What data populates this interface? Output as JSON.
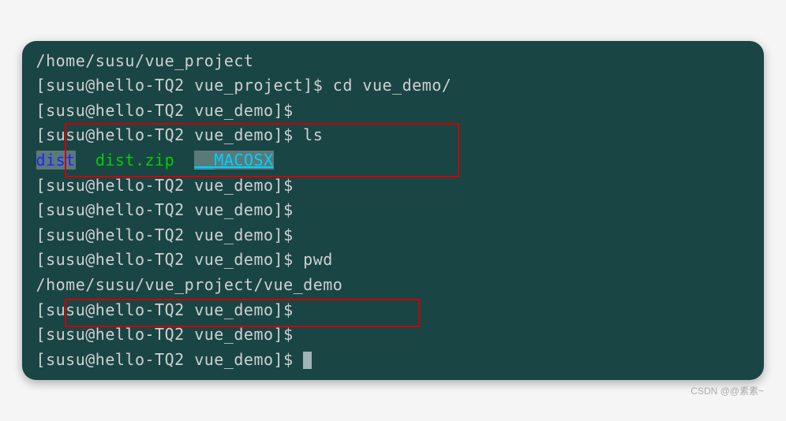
{
  "lines": {
    "pwd_output1": "/home/susu/vue_project",
    "prompt1": "[susu@hello-TQ2 vue_project]$ ",
    "cmd_cd": "cd vue_demo/",
    "prompt_demo": "[susu@hello-TQ2 vue_demo]$ ",
    "cmd_ls": "ls",
    "ls_dist": "dist",
    "ls_distzip": "dist.zip",
    "ls_macosx": "__MACOSX",
    "cmd_pwd": "pwd",
    "pwd_output2": "/home/susu/vue_project/vue_demo"
  },
  "watermark": "CSDN @@素素~"
}
